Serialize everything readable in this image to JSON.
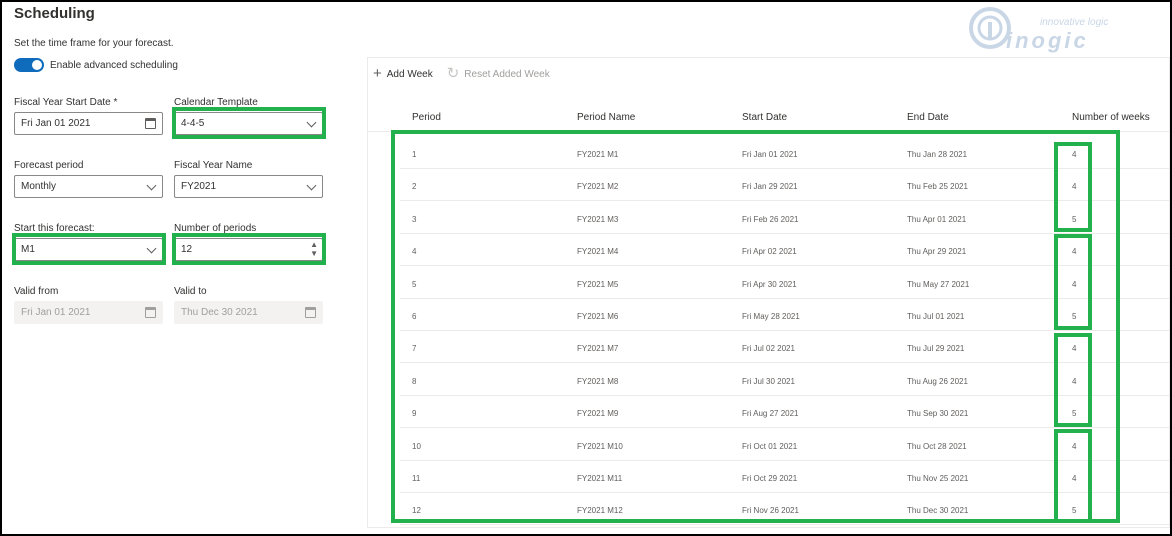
{
  "header": {
    "title": "Scheduling",
    "subtitle": "Set the time frame for your forecast.",
    "toggle_label": "Enable advanced scheduling"
  },
  "form": {
    "fiscal_start": {
      "label": "Fiscal Year Start Date *",
      "value": "Fri Jan 01 2021"
    },
    "calendar_template": {
      "label": "Calendar Template",
      "value": "4-4-5"
    },
    "forecast_period": {
      "label": "Forecast period",
      "value": "Monthly"
    },
    "fiscal_year_name": {
      "label": "Fiscal Year Name",
      "value": "FY2021"
    },
    "start_forecast": {
      "label": "Start this forecast:",
      "value": "M1"
    },
    "number_of_periods": {
      "label": "Number of periods",
      "value": "12"
    },
    "valid_from": {
      "label": "Valid from",
      "value": "Fri Jan 01 2021"
    },
    "valid_to": {
      "label": "Valid to",
      "value": "Thu Dec 30 2021"
    }
  },
  "commands": {
    "add_week": "Add Week",
    "reset_added_week": "Reset Added Week"
  },
  "logo": {
    "small": "innovative logic",
    "big": "inogic"
  },
  "table": {
    "columns": [
      "Period",
      "Period Name",
      "Start Date",
      "End Date",
      "Number of weeks"
    ],
    "rows": [
      [
        "1",
        "FY2021 M1",
        "Fri Jan 01 2021",
        "Thu Jan 28 2021",
        "4"
      ],
      [
        "2",
        "FY2021 M2",
        "Fri Jan 29 2021",
        "Thu Feb 25 2021",
        "4"
      ],
      [
        "3",
        "FY2021 M3",
        "Fri Feb 26 2021",
        "Thu Apr 01 2021",
        "5"
      ],
      [
        "4",
        "FY2021 M4",
        "Fri Apr 02 2021",
        "Thu Apr 29 2021",
        "4"
      ],
      [
        "5",
        "FY2021 M5",
        "Fri Apr 30 2021",
        "Thu May 27 2021",
        "4"
      ],
      [
        "6",
        "FY2021 M6",
        "Fri May 28 2021",
        "Thu Jul 01 2021",
        "5"
      ],
      [
        "7",
        "FY2021 M7",
        "Fri Jul 02 2021",
        "Thu Jul 29 2021",
        "4"
      ],
      [
        "8",
        "FY2021 M8",
        "Fri Jul 30 2021",
        "Thu Aug 26 2021",
        "4"
      ],
      [
        "9",
        "FY2021 M9",
        "Fri Aug 27 2021",
        "Thu Sep 30 2021",
        "5"
      ],
      [
        "10",
        "FY2021 M10",
        "Fri Oct 01 2021",
        "Thu Oct 28 2021",
        "4"
      ],
      [
        "11",
        "FY2021 M11",
        "Fri Oct 29 2021",
        "Thu Nov 25 2021",
        "4"
      ],
      [
        "12",
        "FY2021 M12",
        "Fri Nov 26 2021",
        "Thu Dec 30 2021",
        "5"
      ]
    ]
  },
  "colors": {
    "accent": "#0f6cbd",
    "highlight": "#22b14c"
  }
}
